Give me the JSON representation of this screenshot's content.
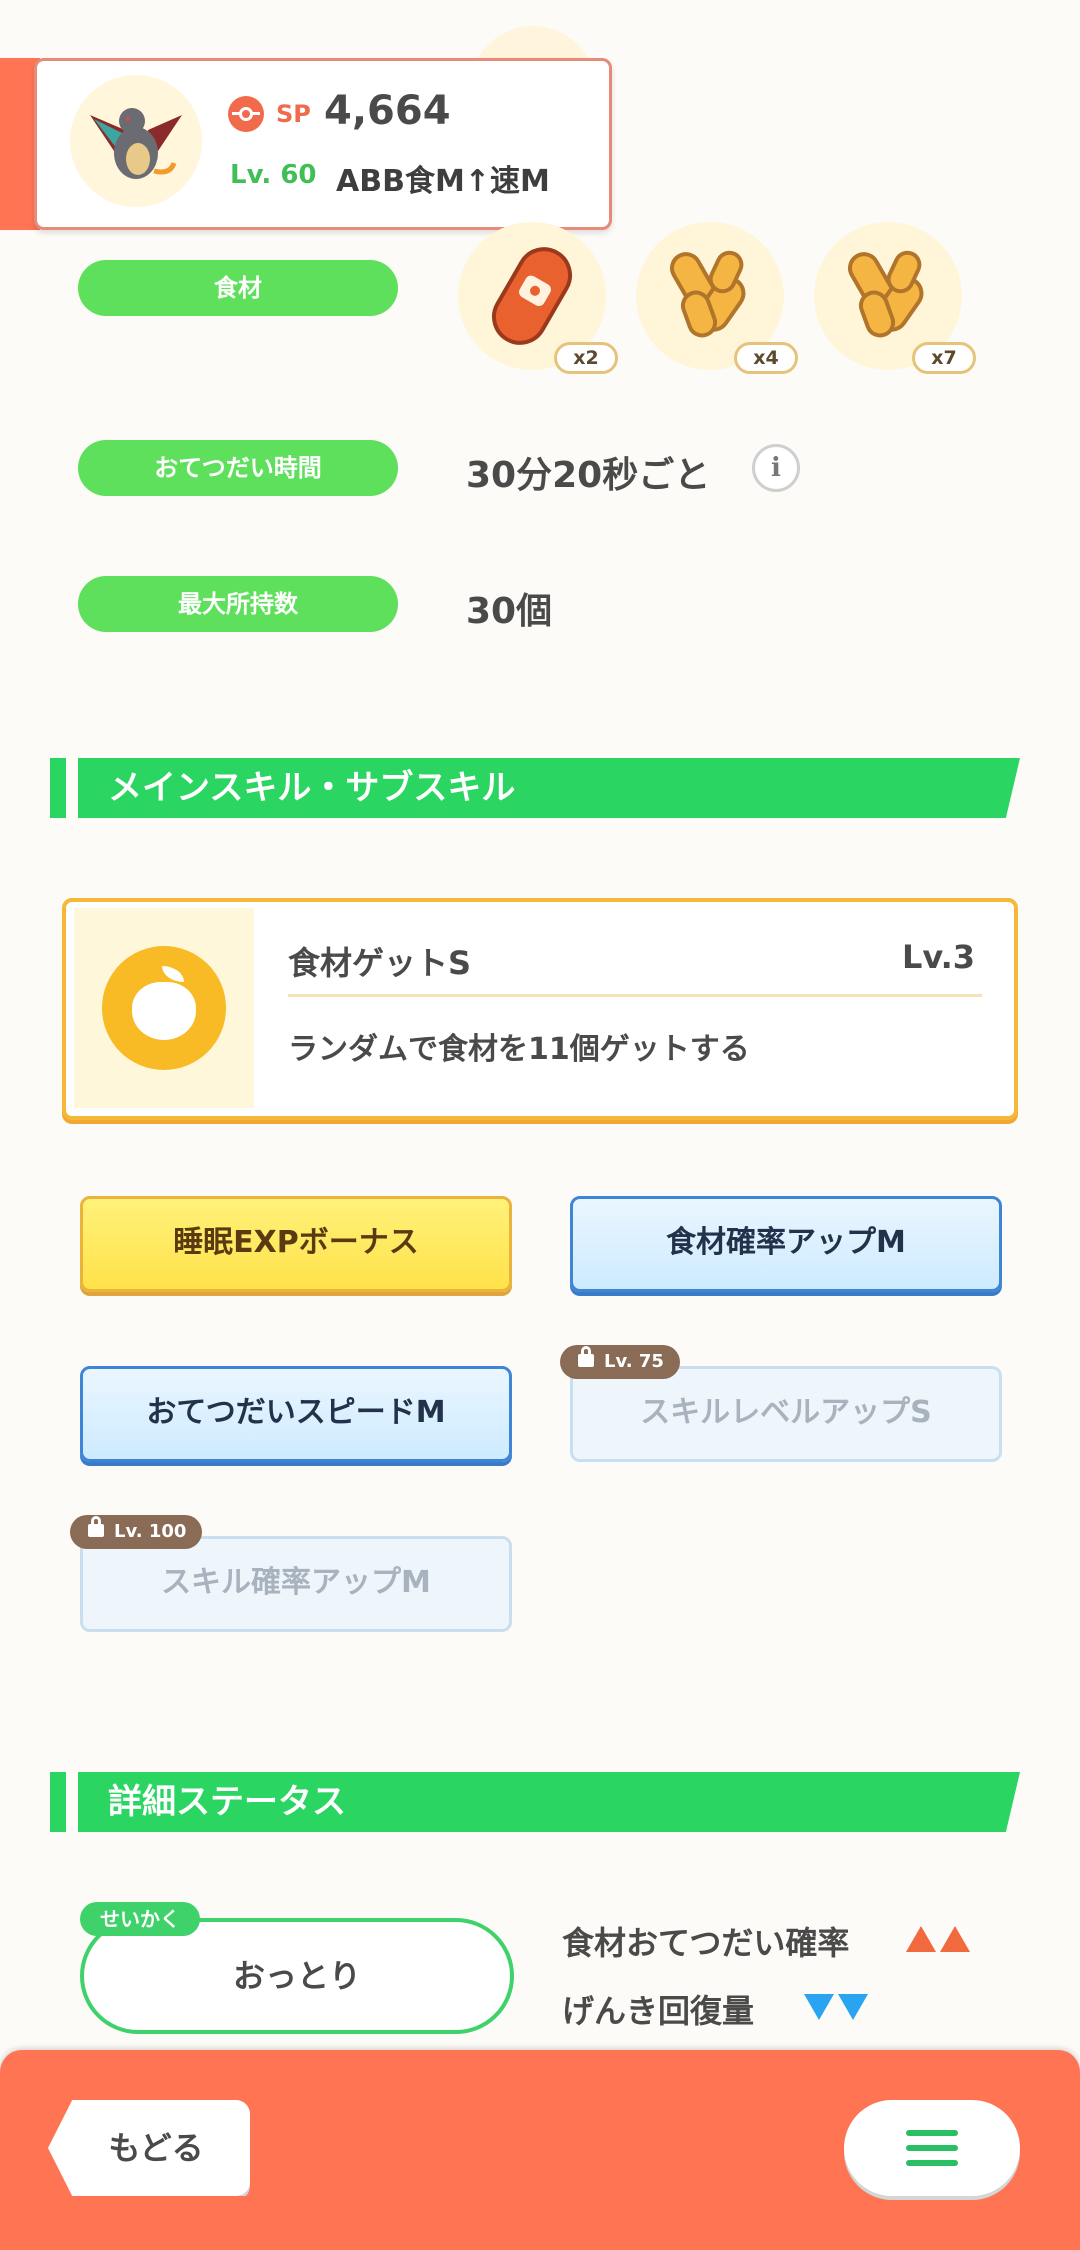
{
  "header": {
    "sp_label": "SP",
    "sp_value": "4,664",
    "level": "Lv. 60",
    "subskill_summary": "ABB食M↑速M"
  },
  "ingredients": {
    "label": "食材",
    "items": [
      {
        "icon": "sausage-icon",
        "count": "x2"
      },
      {
        "icon": "ginger-icon",
        "count": "x4"
      },
      {
        "icon": "ginger-icon",
        "count": "x7"
      }
    ]
  },
  "help_time": {
    "label": "おてつだい時間",
    "value": "30分20秒ごと",
    "info": "i"
  },
  "max_carry": {
    "label": "最大所持数",
    "value": "30個"
  },
  "skills_section": {
    "title": "メインスキル・サブスキル",
    "main_skill": {
      "name": "食材ゲットS",
      "level": "Lv.3",
      "description": "ランダムで食材を11個ゲットする"
    },
    "sub_skills": [
      {
        "label": "睡眠EXPボーナス",
        "style": "gold"
      },
      {
        "label": "食材確率アップM",
        "style": "blue"
      },
      {
        "label": "おてつだいスピードM",
        "style": "blue"
      },
      {
        "label": "スキルレベルアップS",
        "style": "locked",
        "lock_level": "Lv. 75"
      },
      {
        "label": "スキル確率アップM",
        "style": "locked",
        "lock_level": "Lv. 100"
      }
    ]
  },
  "status_section": {
    "title": "詳細ステータス",
    "nature_tag": "せいかく",
    "nature": "おっとり",
    "effects": [
      {
        "label": "食材おてつだい確率",
        "direction": "up"
      },
      {
        "label": "げんき回復量",
        "direction": "down"
      }
    ]
  },
  "bottom_bar": {
    "back_label": "もどる"
  },
  "colors": {
    "accent": "#ff7553",
    "pill_green": "#5ee05c",
    "section_green": "#2bd562",
    "up_arrow": "#f06a3d",
    "down_arrow": "#2aa4f0"
  }
}
